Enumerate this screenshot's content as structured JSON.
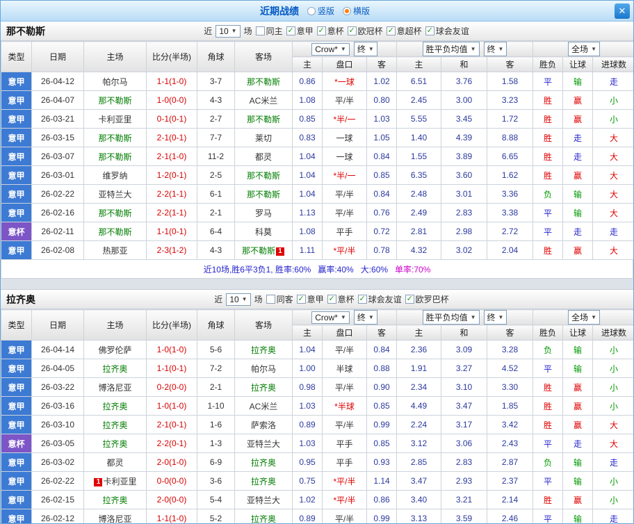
{
  "colors": {
    "win_red": "#e00000",
    "draw_blue": "#2323cc",
    "lose_green": "#009900",
    "focus_team_green": "#007c00",
    "score_red": "#d80000",
    "odds_blue": "#2b3a9e",
    "league_blue": "#3c7ad4",
    "cup_purple": "#7d55c7",
    "handicap_red": "#e00000",
    "handicap_black": "#333333",
    "summary_blue": "#2323cc",
    "summary_magenta": "#cc00cc"
  },
  "header": {
    "title": "近期战绩",
    "radio_vertical": "竖版",
    "radio_horizontal": "横版",
    "close_glyph": "✕"
  },
  "columns": {
    "type": "类型",
    "date": "日期",
    "home": "主场",
    "score": "比分(半场)",
    "corner": "角球",
    "away": "客场",
    "odds_home": "主",
    "handicap": "盘口",
    "odds_away": "客",
    "avg_home": "主",
    "avg_draw": "和",
    "avg_away": "客",
    "result": "胜负",
    "letgoal": "让球",
    "goals": "进球数",
    "dd_company": "Crow*",
    "dd_final": "终",
    "dd_avg": "胜平负均值",
    "dd_final2": "终",
    "dd_scope": "全场"
  },
  "sections": [
    {
      "team": "那不勒斯",
      "filter": {
        "near_label": "近",
        "count": "10",
        "games_label": "场",
        "same_label": "同主",
        "leagues": [
          "意甲",
          "意杯",
          "欧冠杯",
          "意超杯",
          "球会友谊"
        ]
      },
      "rows": [
        {
          "type": "意甲",
          "date": "26-04-12",
          "home": "帕尔马",
          "score": "1-1(1-0)",
          "corner": "3-7",
          "away": "那不勒斯",
          "odds": [
            "0.86",
            "*一球",
            "1.02"
          ],
          "avg": [
            "6.51",
            "3.76",
            "1.58"
          ],
          "result": "平",
          "let": "输",
          "goal": "走"
        },
        {
          "type": "意甲",
          "date": "26-04-07",
          "home": "那不勒斯",
          "score": "1-0(0-0)",
          "corner": "4-3",
          "away": "AC米兰",
          "odds": [
            "1.08",
            "平/半",
            "0.80"
          ],
          "avg": [
            "2.45",
            "3.00",
            "3.23"
          ],
          "result": "胜",
          "let": "赢",
          "goal": "小"
        },
        {
          "type": "意甲",
          "date": "26-03-21",
          "home": "卡利亚里",
          "score": "0-1(0-1)",
          "corner": "2-7",
          "away": "那不勒斯",
          "odds": [
            "0.85",
            "*半/一",
            "1.03"
          ],
          "avg": [
            "5.55",
            "3.45",
            "1.72"
          ],
          "result": "胜",
          "let": "赢",
          "goal": "小"
        },
        {
          "type": "意甲",
          "date": "26-03-15",
          "home": "那不勒斯",
          "score": "2-1(0-1)",
          "corner": "7-7",
          "away": "莱切",
          "odds": [
            "0.83",
            "一球",
            "1.05"
          ],
          "avg": [
            "1.40",
            "4.39",
            "8.88"
          ],
          "result": "胜",
          "let": "走",
          "goal": "大"
        },
        {
          "type": "意甲",
          "date": "26-03-07",
          "home": "那不勒斯",
          "score": "2-1(1-0)",
          "corner": "11-2",
          "away": "都灵",
          "odds": [
            "1.04",
            "一球",
            "0.84"
          ],
          "avg": [
            "1.55",
            "3.89",
            "6.65"
          ],
          "result": "胜",
          "let": "走",
          "goal": "大"
        },
        {
          "type": "意甲",
          "date": "26-03-01",
          "home": "维罗纳",
          "score": "1-2(0-1)",
          "corner": "2-5",
          "away": "那不勒斯",
          "odds": [
            "1.04",
            "*半/一",
            "0.85"
          ],
          "avg": [
            "6.35",
            "3.60",
            "1.62"
          ],
          "result": "胜",
          "let": "赢",
          "goal": "大"
        },
        {
          "type": "意甲",
          "date": "26-02-22",
          "home": "亚特兰大",
          "score": "2-2(1-1)",
          "corner": "6-1",
          "away": "那不勒斯",
          "odds": [
            "1.04",
            "平/半",
            "0.84"
          ],
          "avg": [
            "2.48",
            "3.01",
            "3.36"
          ],
          "result": "负",
          "let": "输",
          "goal": "大"
        },
        {
          "type": "意甲",
          "date": "26-02-16",
          "home": "那不勒斯",
          "score": "2-2(1-1)",
          "corner": "2-1",
          "away": "罗马",
          "odds": [
            "1.13",
            "平/半",
            "0.76"
          ],
          "avg": [
            "2.49",
            "2.83",
            "3.38"
          ],
          "result": "平",
          "let": "输",
          "goal": "大"
        },
        {
          "type": "意杯",
          "date": "26-02-11",
          "home": "那不勒斯",
          "score": "1-1(0-1)",
          "corner": "6-4",
          "away": "科莫",
          "odds": [
            "1.08",
            "平手",
            "0.72"
          ],
          "avg": [
            "2.81",
            "2.98",
            "2.72"
          ],
          "result": "平",
          "let": "走",
          "goal": "走"
        },
        {
          "type": "意甲",
          "date": "26-02-08",
          "home": "热那亚",
          "score": "2-3(1-2)",
          "corner": "4-3",
          "away": "那不勒斯",
          "away_badge": "1",
          "odds": [
            "1.11",
            "*平/半",
            "0.78"
          ],
          "avg": [
            "4.32",
            "3.02",
            "2.04"
          ],
          "result": "胜",
          "let": "赢",
          "goal": "大"
        }
      ],
      "summary": [
        {
          "text": "近10场,胜6平3负1, 胜率:60%",
          "color": "#2323cc"
        },
        {
          "text": "赢率:40%",
          "color": "#2323cc"
        },
        {
          "text": "大:60%",
          "color": "#2323cc"
        },
        {
          "text": "单率:70%",
          "color": "#cc00cc"
        }
      ]
    },
    {
      "team": "拉齐奥",
      "filter": {
        "near_label": "近",
        "count": "10",
        "games_label": "场",
        "same_label": "同客",
        "leagues": [
          "意甲",
          "意杯",
          "球会友谊",
          "欧罗巴杯"
        ]
      },
      "rows": [
        {
          "type": "意甲",
          "date": "26-04-14",
          "home": "佛罗伦萨",
          "score": "1-0(1-0)",
          "corner": "5-6",
          "away": "拉齐奥",
          "odds": [
            "1.04",
            "平/半",
            "0.84"
          ],
          "avg": [
            "2.36",
            "3.09",
            "3.28"
          ],
          "result": "负",
          "let": "输",
          "goal": "小"
        },
        {
          "type": "意甲",
          "date": "26-04-05",
          "home": "拉齐奥",
          "score": "1-1(0-1)",
          "corner": "7-2",
          "away": "帕尔马",
          "odds": [
            "1.00",
            "半球",
            "0.88"
          ],
          "avg": [
            "1.91",
            "3.27",
            "4.52"
          ],
          "result": "平",
          "let": "输",
          "goal": "小"
        },
        {
          "type": "意甲",
          "date": "26-03-22",
          "home": "博洛尼亚",
          "score": "0-2(0-0)",
          "corner": "2-1",
          "away": "拉齐奥",
          "odds": [
            "0.98",
            "平/半",
            "0.90"
          ],
          "avg": [
            "2.34",
            "3.10",
            "3.30"
          ],
          "result": "胜",
          "let": "赢",
          "goal": "小"
        },
        {
          "type": "意甲",
          "date": "26-03-16",
          "home": "拉齐奥",
          "score": "1-0(1-0)",
          "corner": "1-10",
          "away": "AC米兰",
          "odds": [
            "1.03",
            "*半球",
            "0.85"
          ],
          "avg": [
            "4.49",
            "3.47",
            "1.85"
          ],
          "result": "胜",
          "let": "赢",
          "goal": "小"
        },
        {
          "type": "意甲",
          "date": "26-03-10",
          "home": "拉齐奥",
          "score": "2-1(0-1)",
          "corner": "1-6",
          "away": "萨索洛",
          "odds": [
            "0.89",
            "平/半",
            "0.99"
          ],
          "avg": [
            "2.24",
            "3.17",
            "3.42"
          ],
          "result": "胜",
          "let": "赢",
          "goal": "大"
        },
        {
          "type": "意杯",
          "date": "26-03-05",
          "home": "拉齐奥",
          "score": "2-2(0-1)",
          "corner": "1-3",
          "away": "亚特兰大",
          "odds": [
            "1.03",
            "平手",
            "0.85"
          ],
          "avg": [
            "3.12",
            "3.06",
            "2.43"
          ],
          "result": "平",
          "let": "走",
          "goal": "大"
        },
        {
          "type": "意甲",
          "date": "26-03-02",
          "home": "都灵",
          "score": "2-0(1-0)",
          "corner": "6-9",
          "away": "拉齐奥",
          "odds": [
            "0.95",
            "平手",
            "0.93"
          ],
          "avg": [
            "2.85",
            "2.83",
            "2.87"
          ],
          "result": "负",
          "let": "输",
          "goal": "走"
        },
        {
          "type": "意甲",
          "date": "26-02-22",
          "home": "卡利亚里",
          "home_badge": "1",
          "score": "0-0(0-0)",
          "corner": "3-6",
          "away": "拉齐奥",
          "odds": [
            "0.75",
            "*平/半",
            "1.14"
          ],
          "avg": [
            "3.47",
            "2.93",
            "2.37"
          ],
          "result": "平",
          "let": "输",
          "goal": "小"
        },
        {
          "type": "意甲",
          "date": "26-02-15",
          "home": "拉齐奥",
          "score": "2-0(0-0)",
          "corner": "5-4",
          "away": "亚特兰大",
          "odds": [
            "1.02",
            "*平/半",
            "0.86"
          ],
          "avg": [
            "3.40",
            "3.21",
            "2.14"
          ],
          "result": "胜",
          "let": "赢",
          "goal": "小"
        },
        {
          "type": "意甲",
          "date": "26-02-12",
          "home": "博洛尼亚",
          "score": "1-1(1-0)",
          "corner": "5-2",
          "away": "拉齐奥",
          "odds": [
            "0.89",
            "平/半",
            "0.99"
          ],
          "avg": [
            "3.13",
            "3.59",
            "2.46"
          ],
          "result": "平",
          "let": "输",
          "goal": "走"
        }
      ]
    }
  ]
}
